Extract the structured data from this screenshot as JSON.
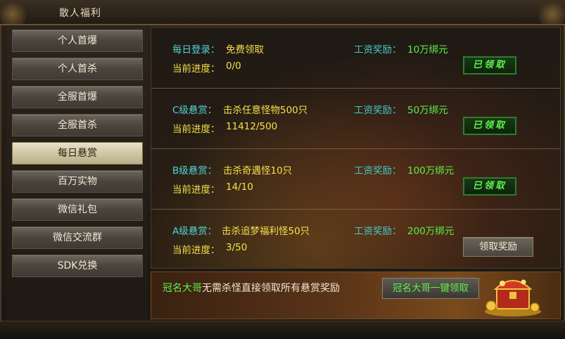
{
  "window": {
    "title": "散人福利"
  },
  "sidebar": {
    "items": [
      {
        "label": "个人首爆"
      },
      {
        "label": "个人首杀"
      },
      {
        "label": "全服首爆"
      },
      {
        "label": "全服首杀"
      },
      {
        "label": "每日悬赏",
        "active": true
      },
      {
        "label": "百万实物"
      },
      {
        "label": "微信礼包"
      },
      {
        "label": "微信交流群"
      },
      {
        "label": "SDK兑换"
      }
    ]
  },
  "tasks": [
    {
      "title_label": "每日登录：",
      "title_value": "免费领取",
      "progress_label": "当前进度：",
      "progress_value": "0/0",
      "reward_label": "工资奖励：",
      "reward_value": "10万绑元",
      "button": "已领取"
    },
    {
      "title_label": "C级悬赏：",
      "title_value": "击杀任意怪物500只",
      "progress_label": "当前进度：",
      "progress_value": "11412/500",
      "reward_label": "工资奖励：",
      "reward_value": "50万绑元",
      "button": "已领取"
    },
    {
      "title_label": "B级悬赏：",
      "title_value": "击杀奇遇怪10只",
      "progress_label": "当前进度：",
      "progress_value": "14/10",
      "reward_label": "工资奖励：",
      "reward_value": "100万绑元",
      "button": "已领取"
    },
    {
      "title_label": "A级悬赏：",
      "title_value": "击杀追梦福利怪50只",
      "progress_label": "当前进度：",
      "progress_value": "3/50",
      "reward_label": "工资奖励：",
      "reward_value": "200万绑元",
      "button": "领取奖励"
    }
  ],
  "banner": {
    "vip_name": "冠名大哥",
    "text": "无需杀怪直接领取所有悬赏奖励",
    "button": "冠名大哥一键领取"
  },
  "colors": {
    "cyan_label": "#4fd3d8",
    "yellow_value": "#f5e14a",
    "green_reward": "#5df04a"
  }
}
